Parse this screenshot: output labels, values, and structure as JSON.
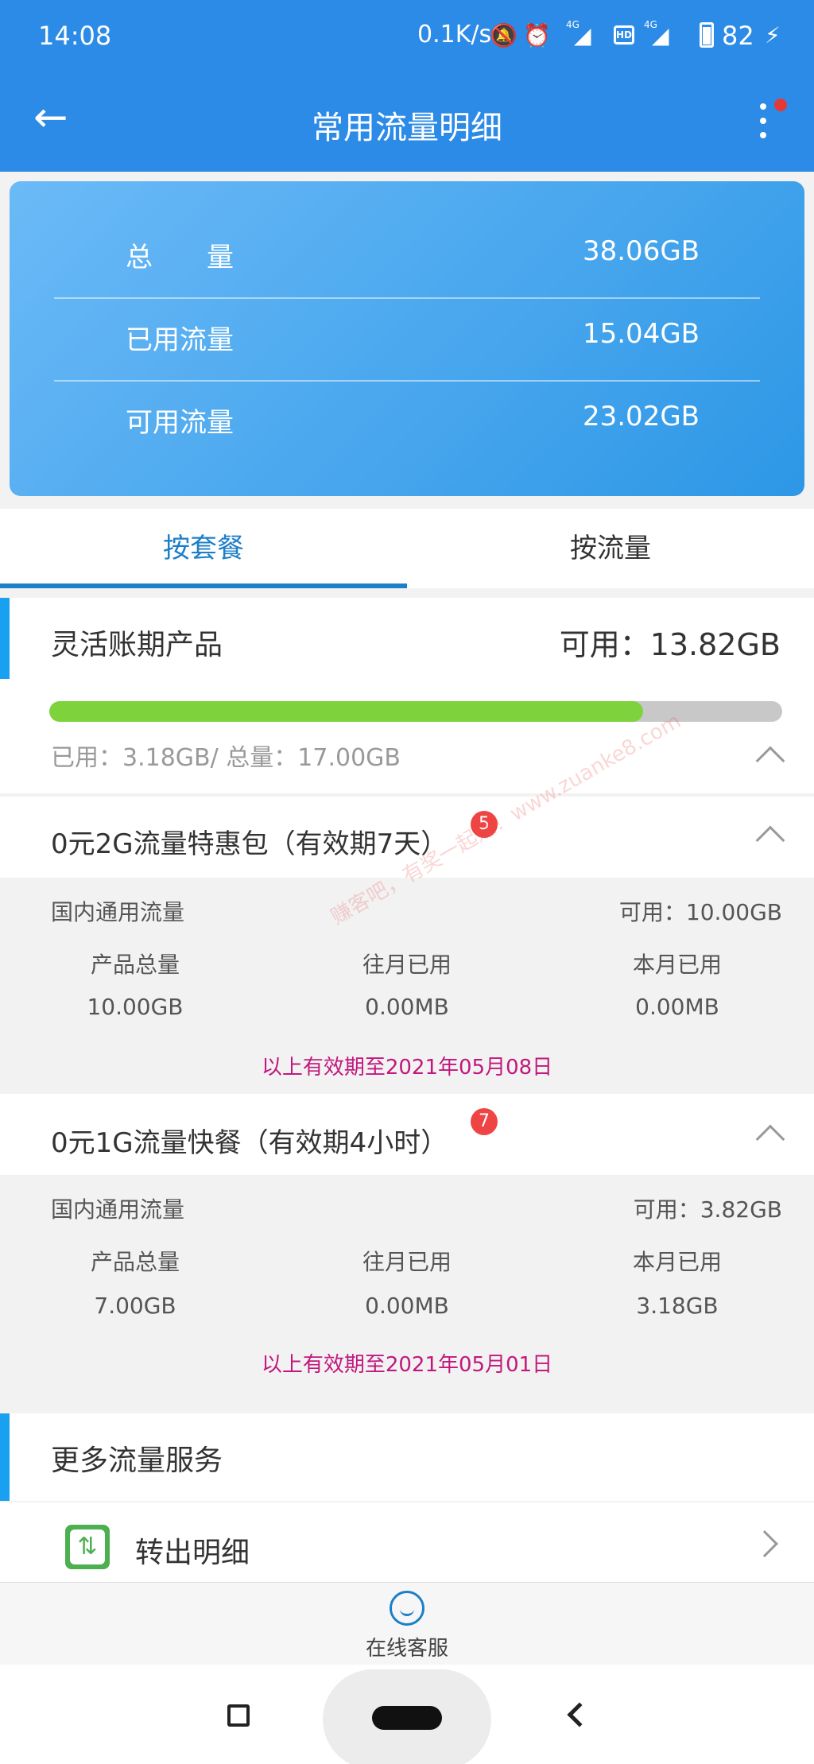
{
  "status_bar": {
    "time": "14:08",
    "net_speed": "0.1K/s",
    "signal1_label": "4G",
    "hd_label": "HD",
    "signal2_label": "4G",
    "battery": "82"
  },
  "app_bar": {
    "title": "常用流量明细"
  },
  "summary": {
    "rows": [
      {
        "label": "总　　量",
        "value": "38.06GB"
      },
      {
        "label": "已用流量",
        "value": "15.04GB"
      },
      {
        "label": "可用流量",
        "value": "23.02GB"
      }
    ]
  },
  "tabs": [
    {
      "label": "按套餐",
      "active": true
    },
    {
      "label": "按流量",
      "active": false
    }
  ],
  "flex_product": {
    "title": "灵活账期产品",
    "available": "可用：13.82GB",
    "used_text": "已用：3.18GB/ 总量：17.00GB",
    "progress": 0.81
  },
  "packages": [
    {
      "title": "0元2G流量特惠包（有效期7天）",
      "badge": "5",
      "scope": "国内通用流量",
      "available": "可用：10.00GB",
      "col_headers": [
        "产品总量",
        "往月已用",
        "本月已用"
      ],
      "col_values": [
        "10.00GB",
        "0.00MB",
        "0.00MB"
      ],
      "validity": "以上有效期至2021年05月08日"
    },
    {
      "title": "0元1G流量快餐（有效期4小时）",
      "badge": "7",
      "scope": "国内通用流量",
      "available": "可用：3.82GB",
      "col_headers": [
        "产品总量",
        "往月已用",
        "本月已用"
      ],
      "col_values": [
        "7.00GB",
        "0.00MB",
        "3.18GB"
      ],
      "validity": "以上有效期至2021年05月01日"
    }
  ],
  "more_services": {
    "title": "更多流量服务",
    "items": [
      {
        "label": "转出明细"
      }
    ]
  },
  "bottom": {
    "service_label": "在线客服"
  },
  "watermark": "赚客吧，有奖一起赚！www.zuanke8.com",
  "colors": {
    "primary": "#2b8be6",
    "tab_active": "#1d7fc8",
    "progress_fill": "#7ed33d",
    "validity_text": "#c2187d",
    "badge": "#ef4444"
  }
}
